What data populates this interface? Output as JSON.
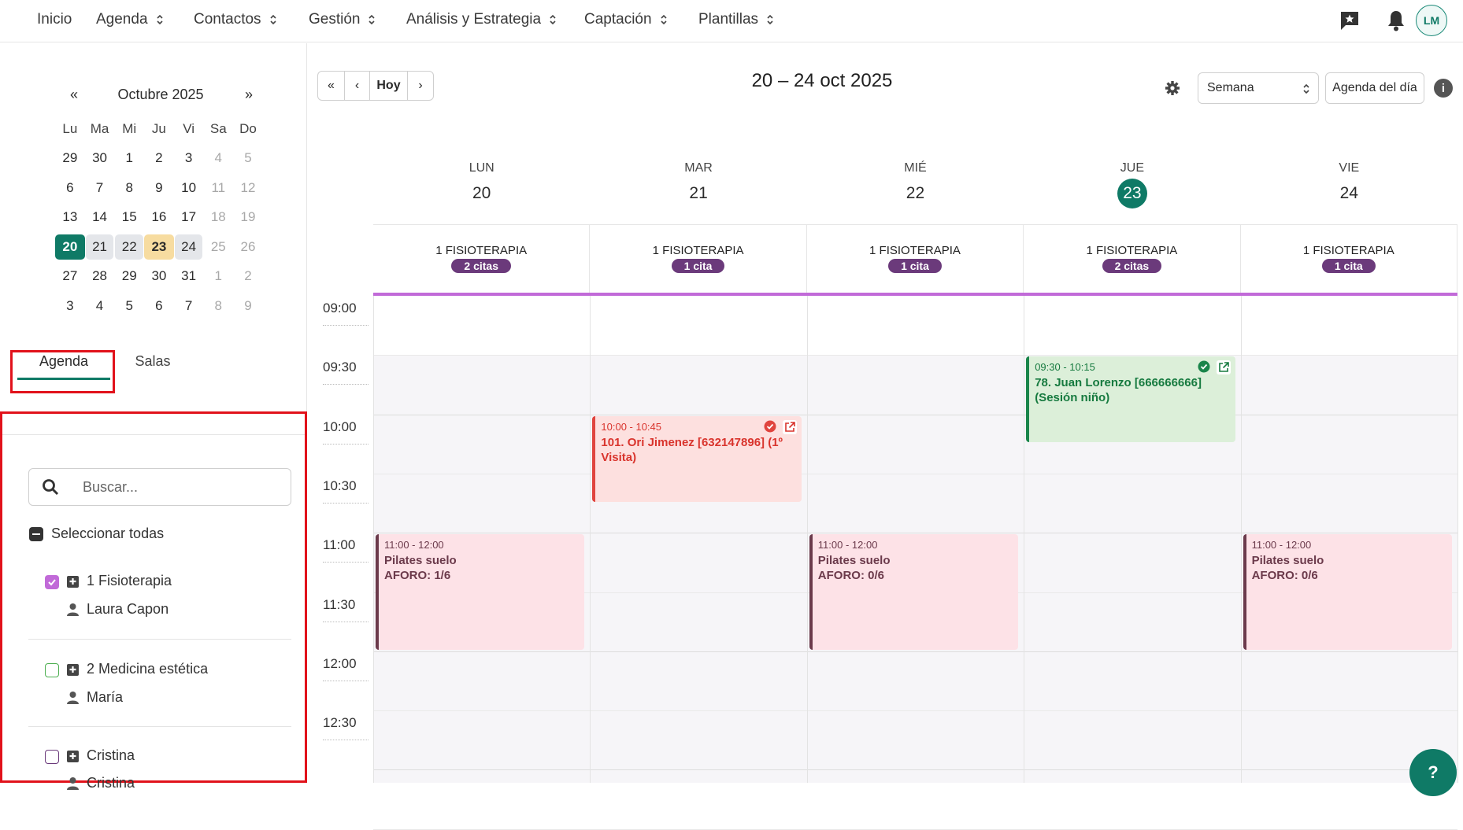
{
  "nav": {
    "items": [
      {
        "label": "Inicio",
        "dropdown": false
      },
      {
        "label": "Agenda",
        "dropdown": true
      },
      {
        "label": "Contactos",
        "dropdown": true
      },
      {
        "label": "Gestión",
        "dropdown": true
      },
      {
        "label": "Análisis y Estrategia",
        "dropdown": true
      },
      {
        "label": "Captación",
        "dropdown": true
      },
      {
        "label": "Plantillas",
        "dropdown": true
      }
    ],
    "avatar_initials": "LM",
    "icons": [
      "star-message-icon",
      "bell-icon"
    ]
  },
  "minical": {
    "prev": "«",
    "next": "»",
    "month": "Octubre 2025",
    "dow": [
      "Lu",
      "Ma",
      "Mi",
      "Ju",
      "Vi",
      "Sa",
      "Do"
    ],
    "weeks": [
      [
        "29",
        "30",
        "1",
        "2",
        "3",
        "4",
        "5"
      ],
      [
        "6",
        "7",
        "8",
        "9",
        "10",
        "11",
        "12"
      ],
      [
        "13",
        "14",
        "15",
        "16",
        "17",
        "18",
        "19"
      ],
      [
        "20",
        "21",
        "22",
        "23",
        "24",
        "25",
        "26"
      ],
      [
        "27",
        "28",
        "29",
        "30",
        "31",
        "1",
        "2"
      ],
      [
        "3",
        "4",
        "5",
        "6",
        "7",
        "8",
        "9"
      ]
    ]
  },
  "tabs": {
    "agenda": "Agenda",
    "salas": "Salas"
  },
  "filters": {
    "search_placeholder": "Buscar...",
    "select_all": "Seleccionar todas",
    "items": [
      {
        "name": "1 Fisioterapia",
        "person": "Laura Capon",
        "checked": true,
        "color": "#c16ad8"
      },
      {
        "name": "2 Medicina estética",
        "person": "María",
        "checked": false,
        "color": "#4caf50"
      },
      {
        "name": "Cristina",
        "person": "Cristina",
        "checked": false,
        "color": "#6b3a7b"
      }
    ]
  },
  "calendar": {
    "nav": {
      "first": "«",
      "prev": "‹",
      "today": "Hoy",
      "next": "›"
    },
    "range": "20 – 24 oct 2025",
    "view": "Semana",
    "day_agenda": "Agenda del día",
    "days": [
      {
        "dow": "LUN",
        "num": "20",
        "res": "1 FISIOTERAPIA",
        "count": "2 citas"
      },
      {
        "dow": "MAR",
        "num": "21",
        "res": "1 FISIOTERAPIA",
        "count": "1 cita"
      },
      {
        "dow": "MIÉ",
        "num": "22",
        "res": "1 FISIOTERAPIA",
        "count": "1 cita"
      },
      {
        "dow": "JUE",
        "num": "23",
        "res": "1 FISIOTERAPIA",
        "count": "2 citas",
        "today": true
      },
      {
        "dow": "VIE",
        "num": "24",
        "res": "1 FISIOTERAPIA",
        "count": "1 cita"
      }
    ],
    "times": [
      "09:00",
      "09:30",
      "10:00",
      "10:30",
      "11:00",
      "11:30",
      "12:00",
      "12:30"
    ],
    "events": [
      {
        "day": 1,
        "start": "10:00",
        "end": "10:45",
        "time": "10:00 - 10:45",
        "title": "101. Ori Jimenez [632147896] (1º Visita)",
        "kind": "red"
      },
      {
        "day": 3,
        "start": "09:30",
        "end": "10:15",
        "time": "09:30 - 10:15",
        "title": "78. Juan Lorenzo [666666666] (Sesión niño)",
        "kind": "green"
      },
      {
        "day": 0,
        "start": "11:00",
        "end": "12:00",
        "time": "11:00 - 12:00",
        "title": "Pilates suelo",
        "sub": "AFORO: 1/6",
        "kind": "pink"
      },
      {
        "day": 2,
        "start": "11:00",
        "end": "12:00",
        "time": "11:00 - 12:00",
        "title": "Pilates suelo",
        "sub": "AFORO: 0/6",
        "kind": "pink"
      },
      {
        "day": 4,
        "start": "11:00",
        "end": "12:00",
        "time": "11:00 - 12:00",
        "title": "Pilates suelo",
        "sub": "AFORO: 0/6",
        "kind": "pink"
      }
    ],
    "help": "?"
  }
}
